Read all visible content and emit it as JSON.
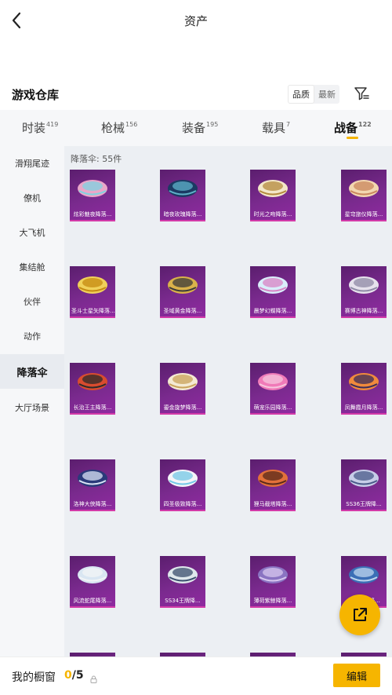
{
  "header": {
    "title": "资产"
  },
  "warehouse": {
    "title": "游戏仓库",
    "sort_options": [
      "品质",
      "最新"
    ]
  },
  "tabs": [
    {
      "label": "时装",
      "count": "419"
    },
    {
      "label": "枪械",
      "count": "156"
    },
    {
      "label": "装备",
      "count": "195"
    },
    {
      "label": "载具",
      "count": "7"
    },
    {
      "label": "战备",
      "count": "122"
    }
  ],
  "active_tab": "战备",
  "sidebar": {
    "items": [
      "滑翔尾迹",
      "僚机",
      "大飞机",
      "集结舱",
      "伙伴",
      "动作",
      "降落伞",
      "大厅场景"
    ],
    "active": "降落伞"
  },
  "content": {
    "count_label": "降落伞: 55件",
    "items": [
      {
        "name": "炫彩魅夜降落...",
        "colors": [
          "#e9a7c9",
          "#7fd3e0"
        ]
      },
      {
        "name": "暗夜玫瑰降落...",
        "colors": [
          "#1b3a63",
          "#5fb1c9"
        ]
      },
      {
        "name": "时光之吻降落...",
        "colors": [
          "#f3e7c8",
          "#b48a3e"
        ]
      },
      {
        "name": "星穹旅仪降落...",
        "colors": [
          "#f2d7b0",
          "#c9875e"
        ]
      },
      {
        "name": "圣斗士星矢降落...",
        "colors": [
          "#f0d15a",
          "#c58a12"
        ]
      },
      {
        "name": "圣域黄金降落...",
        "colors": [
          "#d9b24a",
          "#3a3a3a"
        ]
      },
      {
        "name": "晨梦幻蝶降落...",
        "colors": [
          "#d9eefa",
          "#d883c4"
        ]
      },
      {
        "name": "赛博古神降落...",
        "colors": [
          "#e6e2ec",
          "#8f8aa6"
        ]
      },
      {
        "name": "长治王主降落...",
        "colors": [
          "#d84c2f",
          "#2b2b2b"
        ]
      },
      {
        "name": "鎏金旋梦降落...",
        "colors": [
          "#f4ead3",
          "#c9a25a"
        ]
      },
      {
        "name": "萌宠乐园降落...",
        "colors": [
          "#f07ab8",
          "#f6c7de"
        ]
      },
      {
        "name": "凤舞霞月降落...",
        "colors": [
          "#f08a3c",
          "#3a2b5a"
        ]
      },
      {
        "name": "洛神大侠降落...",
        "colors": [
          "#2a3a7a",
          "#d9e3f5"
        ]
      },
      {
        "name": "四圣极致降落...",
        "colors": [
          "#f4f4f8",
          "#74c8e6"
        ]
      },
      {
        "name": "狸马截塔降落...",
        "colors": [
          "#e2713a",
          "#5a2a1a"
        ]
      },
      {
        "name": "SS36王牌降...",
        "colors": [
          "#c7cde8",
          "#4a5a8a"
        ]
      },
      {
        "name": "风流蛇尾降落...",
        "colors": [
          "#d9e6f2",
          "#f2f4f6"
        ]
      },
      {
        "name": "SS34王牌降...",
        "colors": [
          "#dfe8ec",
          "#3b4f6e"
        ]
      },
      {
        "name": "薄荷紫鲸降落...",
        "colors": [
          "#8a74c2",
          "#d7c7ee"
        ]
      },
      {
        "name": "星月深海降...",
        "colors": [
          "#3b6fb6",
          "#bfd6ee"
        ]
      },
      {
        "name": "",
        "colors": [
          "#5a3a7a",
          "#9a7ac2"
        ]
      },
      {
        "name": "",
        "colors": [
          "#5a3a7a",
          "#9a7ac2"
        ]
      },
      {
        "name": "",
        "colors": [
          "#5a3a7a",
          "#9a7ac2"
        ]
      },
      {
        "name": "",
        "colors": [
          "#5a3a7a",
          "#9a7ac2"
        ]
      }
    ]
  },
  "bottom": {
    "label": "我的橱窗",
    "current": "0",
    "total": "/5",
    "edit_label": "编辑"
  },
  "colors": {
    "accent": "#f6b500",
    "card_bg": "#7a2a8e",
    "card_border": "#d33aa8"
  }
}
